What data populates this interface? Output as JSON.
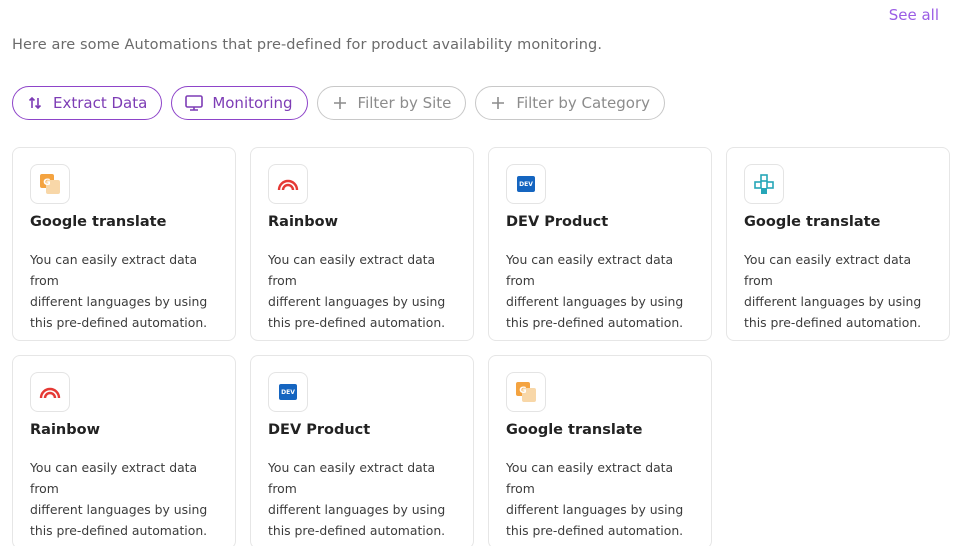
{
  "header": {
    "see_all": "See all",
    "intro": "Here are some Automations that pre-defined for product availability monitoring."
  },
  "filters": [
    {
      "label": "Extract Data",
      "icon": "sort-arrows-icon",
      "active": true
    },
    {
      "label": "Monitoring",
      "icon": "monitor-icon",
      "active": true
    },
    {
      "label": "Filter by Site",
      "icon": "plus-icon",
      "active": false
    },
    {
      "label": "Filter by Category",
      "icon": "plus-icon",
      "active": false
    }
  ],
  "cards": [
    {
      "title": "Google translate",
      "logo": "google-translate-icon",
      "desc_lines": [
        "You can easily extract data from",
        "different languages by using",
        "this pre-defined automation."
      ]
    },
    {
      "title": "Rainbow",
      "logo": "rainbow-icon",
      "desc_lines": [
        "You can easily extract data from",
        "different languages by using",
        "this pre-defined automation."
      ]
    },
    {
      "title": "DEV Product",
      "logo": "dev-icon",
      "logo_text": "DEV",
      "desc_lines": [
        "You can easily extract data from",
        "different languages by using",
        "this pre-defined automation."
      ]
    },
    {
      "title": "Google translate",
      "logo": "network-nodes-icon",
      "desc_lines": [
        "You can easily extract data from",
        "different languages by using",
        "this pre-defined automation."
      ]
    },
    {
      "title": "Rainbow",
      "logo": "rainbow-icon",
      "desc_lines": [
        "You can easily extract data from",
        "different languages by using",
        "this pre-defined automation."
      ]
    },
    {
      "title": "DEV Product",
      "logo": "dev-icon",
      "logo_text": "DEV",
      "desc_lines": [
        "You can easily extract data from",
        "different languages by using",
        "this pre-defined automation."
      ]
    },
    {
      "title": "Google translate",
      "logo": "google-translate-icon",
      "desc_lines": [
        "You can easily extract data from",
        "different languages by using",
        "this pre-defined automation."
      ]
    }
  ],
  "colors": {
    "accent": "#8e44c9",
    "rainbow": "#e53935",
    "dev": "#1565c0",
    "translate": "#f4a340",
    "nodes": "#26a6b8"
  }
}
